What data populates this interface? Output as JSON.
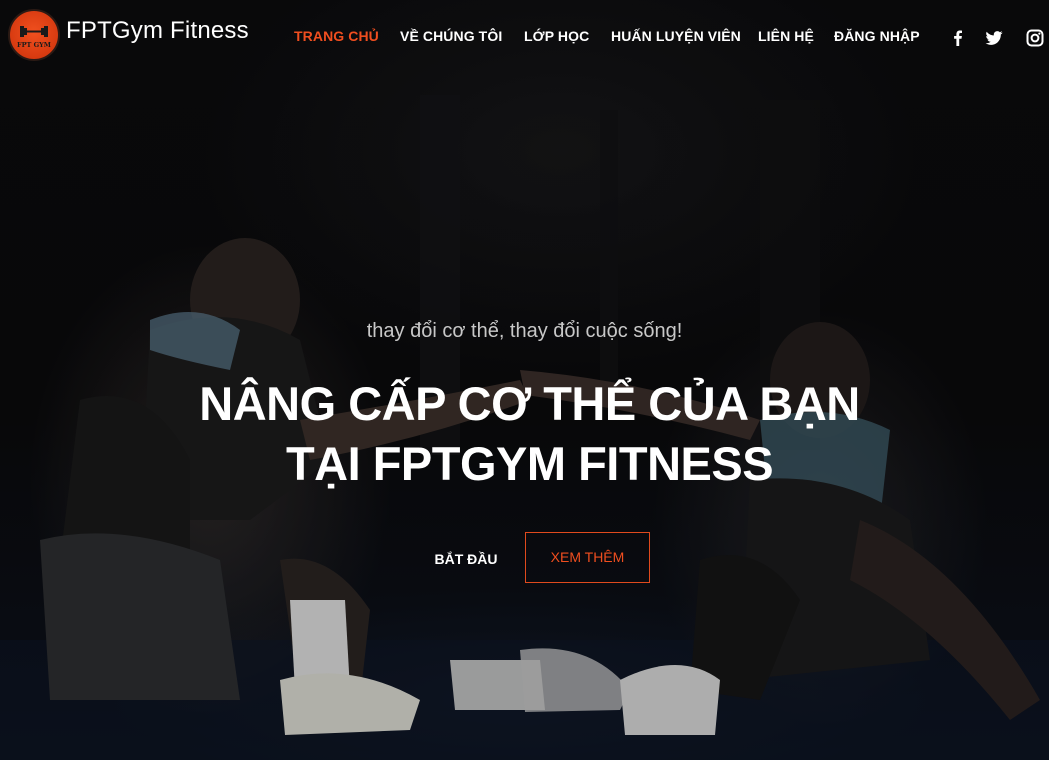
{
  "header": {
    "brand": "FPTGym Fitness",
    "logo_text": "FPT GYM",
    "nav": [
      {
        "label": "TRANG CHỦ",
        "active": true
      },
      {
        "label": "VỀ CHÚNG TÔI",
        "active": false
      },
      {
        "label": "LỚP HỌC",
        "active": false
      },
      {
        "label": "HUẤN LUYỆN VIÊN",
        "active": false
      },
      {
        "label": "LIÊN HỆ",
        "active": false
      },
      {
        "label": "ĐĂNG NHẬP",
        "active": false
      }
    ],
    "social": [
      "facebook-icon",
      "twitter-icon",
      "instagram-icon"
    ]
  },
  "hero": {
    "tagline": "thay đổi cơ thể, thay đổi cuộc sống!",
    "headline_line1": "NÂNG CẤP CƠ THỂ CỦA BẠN",
    "headline_line2": "TẠI FPTGYM FITNESS",
    "start_label": "BẮT ĐẦU",
    "more_label": "XEM THÊM"
  },
  "colors": {
    "accent": "#f04e1f",
    "background": "#0a0a0c",
    "text": "#ffffff",
    "tagline": "#c8c8c8"
  }
}
